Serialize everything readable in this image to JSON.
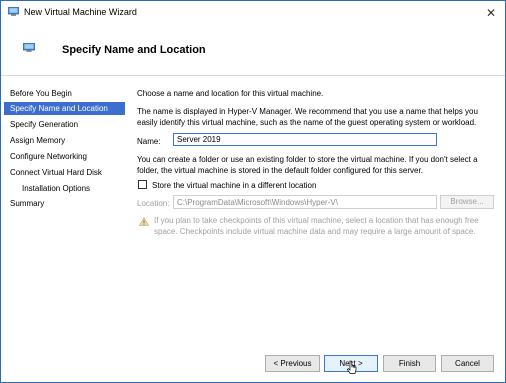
{
  "window": {
    "title": "New Virtual Machine Wizard"
  },
  "header": {
    "title": "Specify Name and Location"
  },
  "sidebar": {
    "items": [
      {
        "label": "Before You Begin"
      },
      {
        "label": "Specify Name and Location",
        "active": true
      },
      {
        "label": "Specify Generation"
      },
      {
        "label": "Assign Memory"
      },
      {
        "label": "Configure Networking"
      },
      {
        "label": "Connect Virtual Hard Disk"
      },
      {
        "label": "Installation Options",
        "sub": true
      },
      {
        "label": "Summary"
      }
    ]
  },
  "main": {
    "intro": "Choose a name and location for this virtual machine.",
    "description": "The name is displayed in Hyper-V Manager. We recommend that you use a name that helps you easily identify this virtual machine, such as the name of the guest operating system or workload.",
    "name_label": "Name:",
    "name_value": "Server 2019",
    "folder_text": "You can create a folder or use an existing folder to store the virtual machine. If you don't select a folder, the virtual machine is stored in the default folder configured for this server.",
    "store_checkbox_label": "Store the virtual machine in a different location",
    "store_checkbox_checked": false,
    "location_label": "Location:",
    "location_value": "C:\\ProgramData\\Microsoft\\Windows\\Hyper-V\\",
    "browse_label": "Browse...",
    "warning_text": "If you plan to take checkpoints of this virtual machine, select a location that has enough free space. Checkpoints include virtual machine data and may require a large amount of space."
  },
  "footer": {
    "previous_label": "< Previous",
    "next_label": "Next >",
    "finish_label": "Finish",
    "cancel_label": "Cancel"
  },
  "colors": {
    "accent": "#3b6ecf",
    "window_border": "#2b6cb8",
    "muted_text": "#a0a0a0"
  },
  "icons": [
    "vm-icon",
    "close-icon",
    "warning-icon",
    "mouse-cursor-icon"
  ]
}
